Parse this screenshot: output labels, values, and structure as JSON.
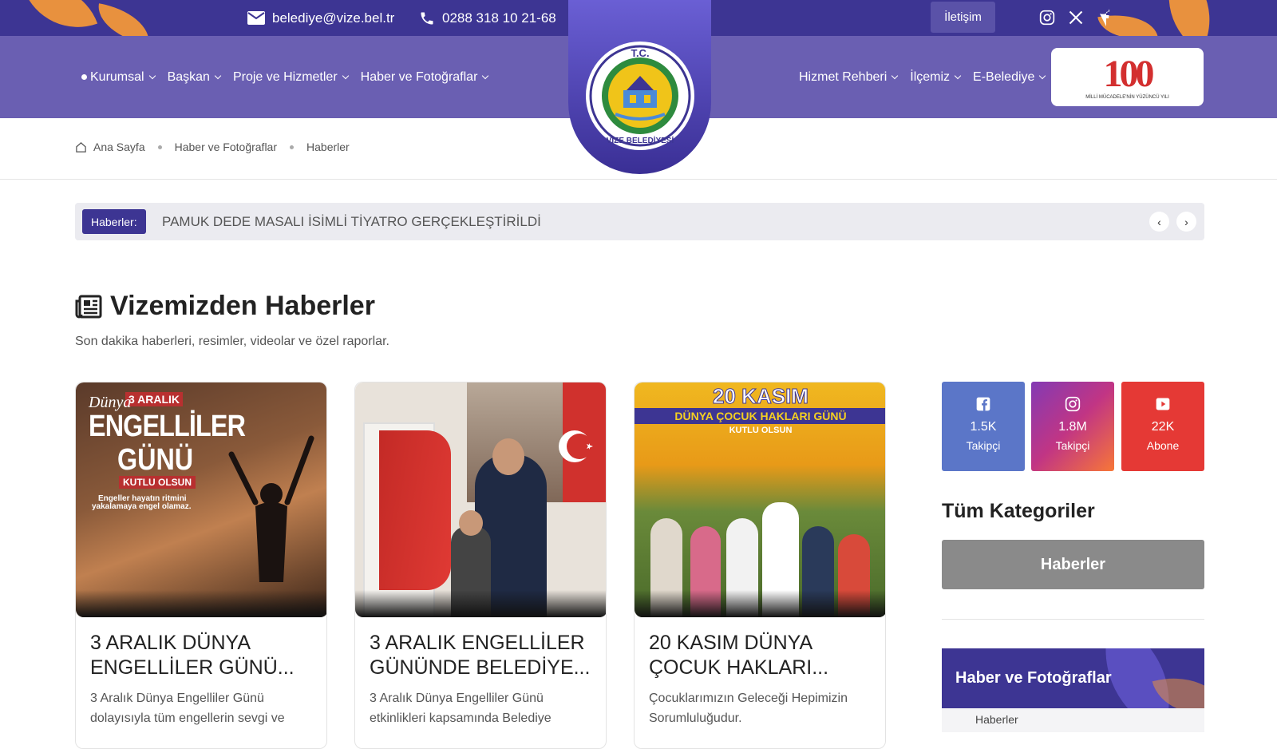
{
  "topbar": {
    "email": "belediye@vize.bel.tr",
    "phone": "0288 318 10 21-68",
    "contact_button": "İletişim"
  },
  "nav": {
    "left": [
      "Kurumsal",
      "Başkan",
      "Proje ve Hizmetler",
      "Haber ve Fotoğraflar"
    ],
    "right": [
      "Hizmet Rehberi",
      "İlçemiz",
      "E-Belediye"
    ]
  },
  "logo": {
    "top_text": "T.C.",
    "bottom_text": "VİZE BELEDİYESİ"
  },
  "badge100": {
    "number": "100",
    "caption": "MİLLİ MÜCADELE'NİN YÜZÜNCÜ YILI"
  },
  "breadcrumb": [
    "Ana Sayfa",
    "Haber ve Fotoğraflar",
    "Haberler"
  ],
  "ticker": {
    "label": "Haberler:",
    "text": "PAMUK DEDE MASALI İSİMLİ TİYATRO GERÇEKLEŞTİRİLDİ"
  },
  "section": {
    "title": "Vizemizden Haberler",
    "subtitle": "Son dakika haberleri, resimler, videolar ve özel raporlar."
  },
  "cards": [
    {
      "title": "3 ARALIK DÜNYA ENGELLİLER GÜNÜ...",
      "text": "3 Aralık Dünya Engelliler Günü dolayısıyla tüm engellerin sevgi ve",
      "img": {
        "small": "3 ARALIK",
        "script": "Dünya",
        "big1": "ENGELLİLER",
        "big2": "GÜNÜ",
        "tag": "KUTLU OLSUN",
        "quote1": "Engeller hayatın ritmini",
        "quote2": "yakalamaya engel olamaz."
      }
    },
    {
      "title": "3 ARALIK ENGELLİLER GÜNÜNDE BELEDİYE...",
      "text": "3 Aralık Dünya Engelliler Günü etkinlikleri kapsamında Belediye"
    },
    {
      "title": "20 KASIM DÜNYA ÇOCUK HAKLARI...",
      "text": "Çocuklarımızın Geleceği Hepimizin Sorumluluğudur.",
      "img": {
        "big": "20 KASIM",
        "line2": "DÜNYA ÇOCUK HAKLARI GÜNÜ",
        "line3": "KUTLU OLSUN"
      }
    }
  ],
  "social": [
    {
      "icon": "facebook-icon",
      "count": "1.5K",
      "label": "Takipçi",
      "color": "#5b76c8"
    },
    {
      "icon": "instagram-icon",
      "count": "1.8M",
      "label": "Takipçi",
      "color": "#c13584"
    },
    {
      "icon": "youtube-icon",
      "count": "22K",
      "label": "Abone",
      "color": "#e53935"
    }
  ],
  "sidebar": {
    "categories_title": "Tüm Kategoriler",
    "category_button": "Haberler",
    "panel_title": "Haber ve Fotoğraflar",
    "panel_item": "Haberler"
  },
  "colors": {
    "topbar": "#3d3593",
    "nav": "#6a5fb2",
    "accent_orange": "#e8913e"
  }
}
